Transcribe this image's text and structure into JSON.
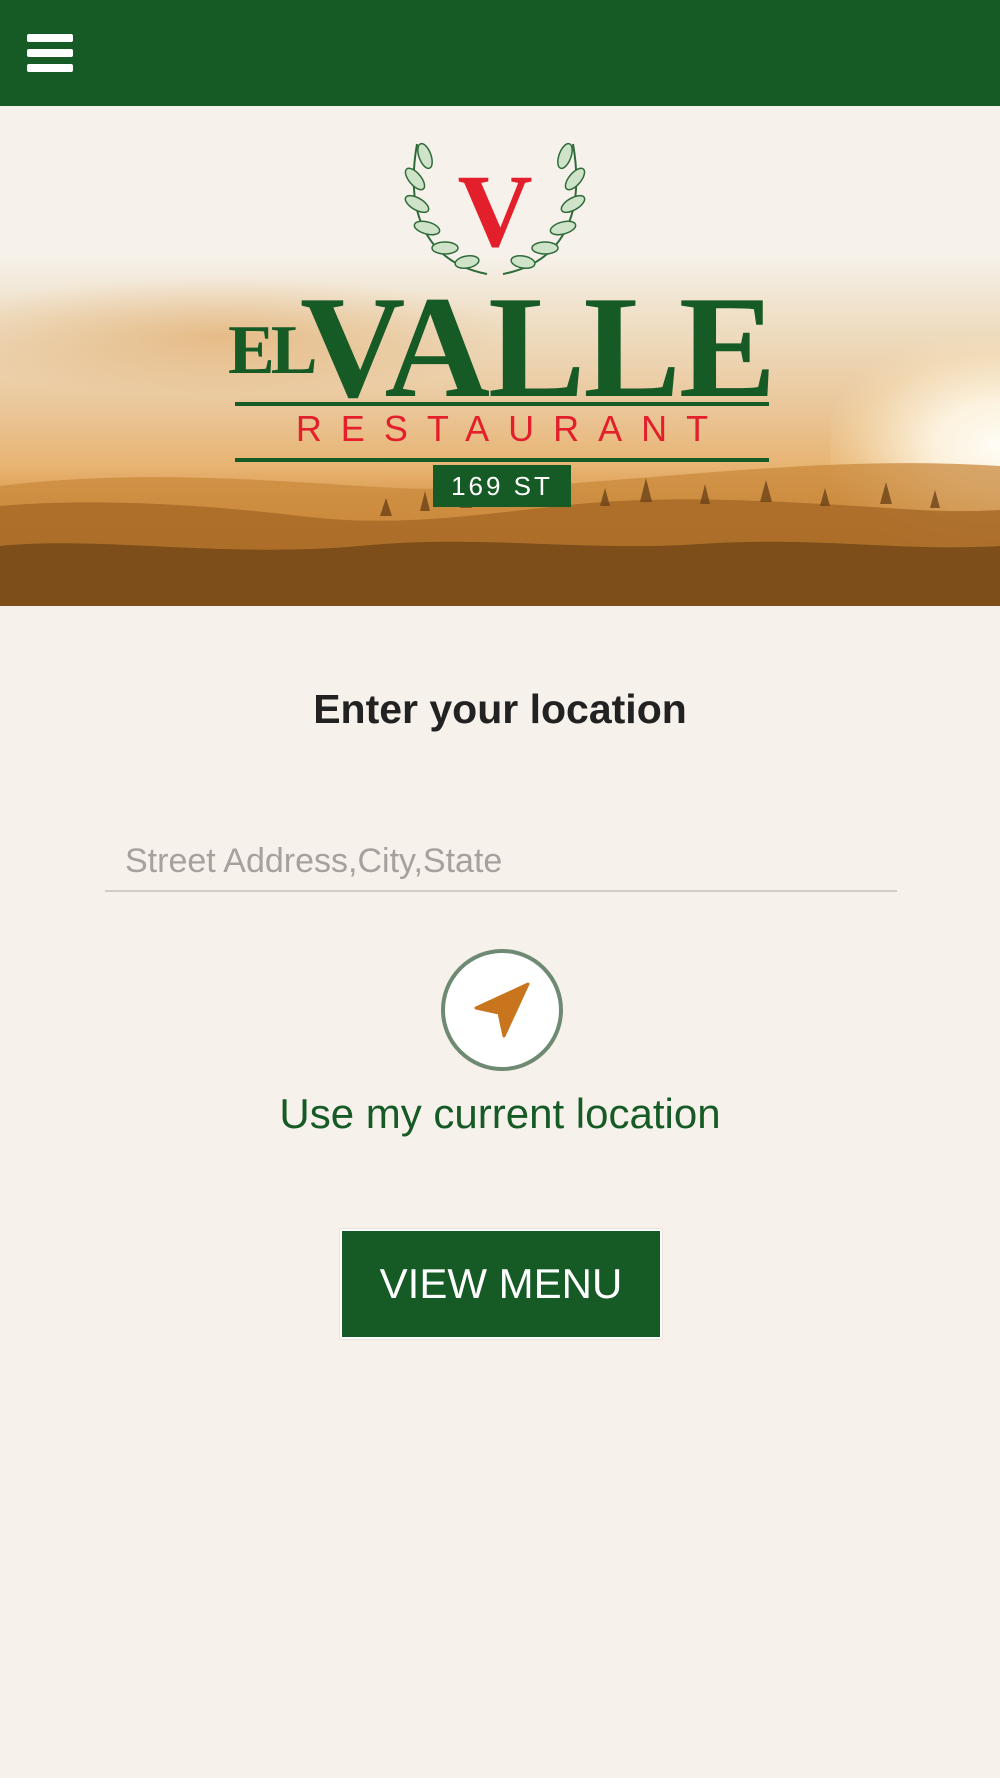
{
  "header": {
    "menu_icon": "hamburger-menu-icon",
    "background_color": "#165a26"
  },
  "logo": {
    "emblem_letter": "V",
    "el": "EL",
    "valle": "VALLE",
    "restaurant": "RESTAURANT",
    "street": "169 ST",
    "green": "#165a26",
    "red": "#e21f2a"
  },
  "location": {
    "heading": "Enter your location",
    "address_placeholder": "Street Address,City,State",
    "address_value": "",
    "locate_icon": "navigation-arrow-icon",
    "current_location_label": "Use my current location"
  },
  "actions": {
    "view_menu_label": "VIEW MENU"
  },
  "colors": {
    "background": "#f6f1ea",
    "accent_orange": "#c8751e"
  }
}
